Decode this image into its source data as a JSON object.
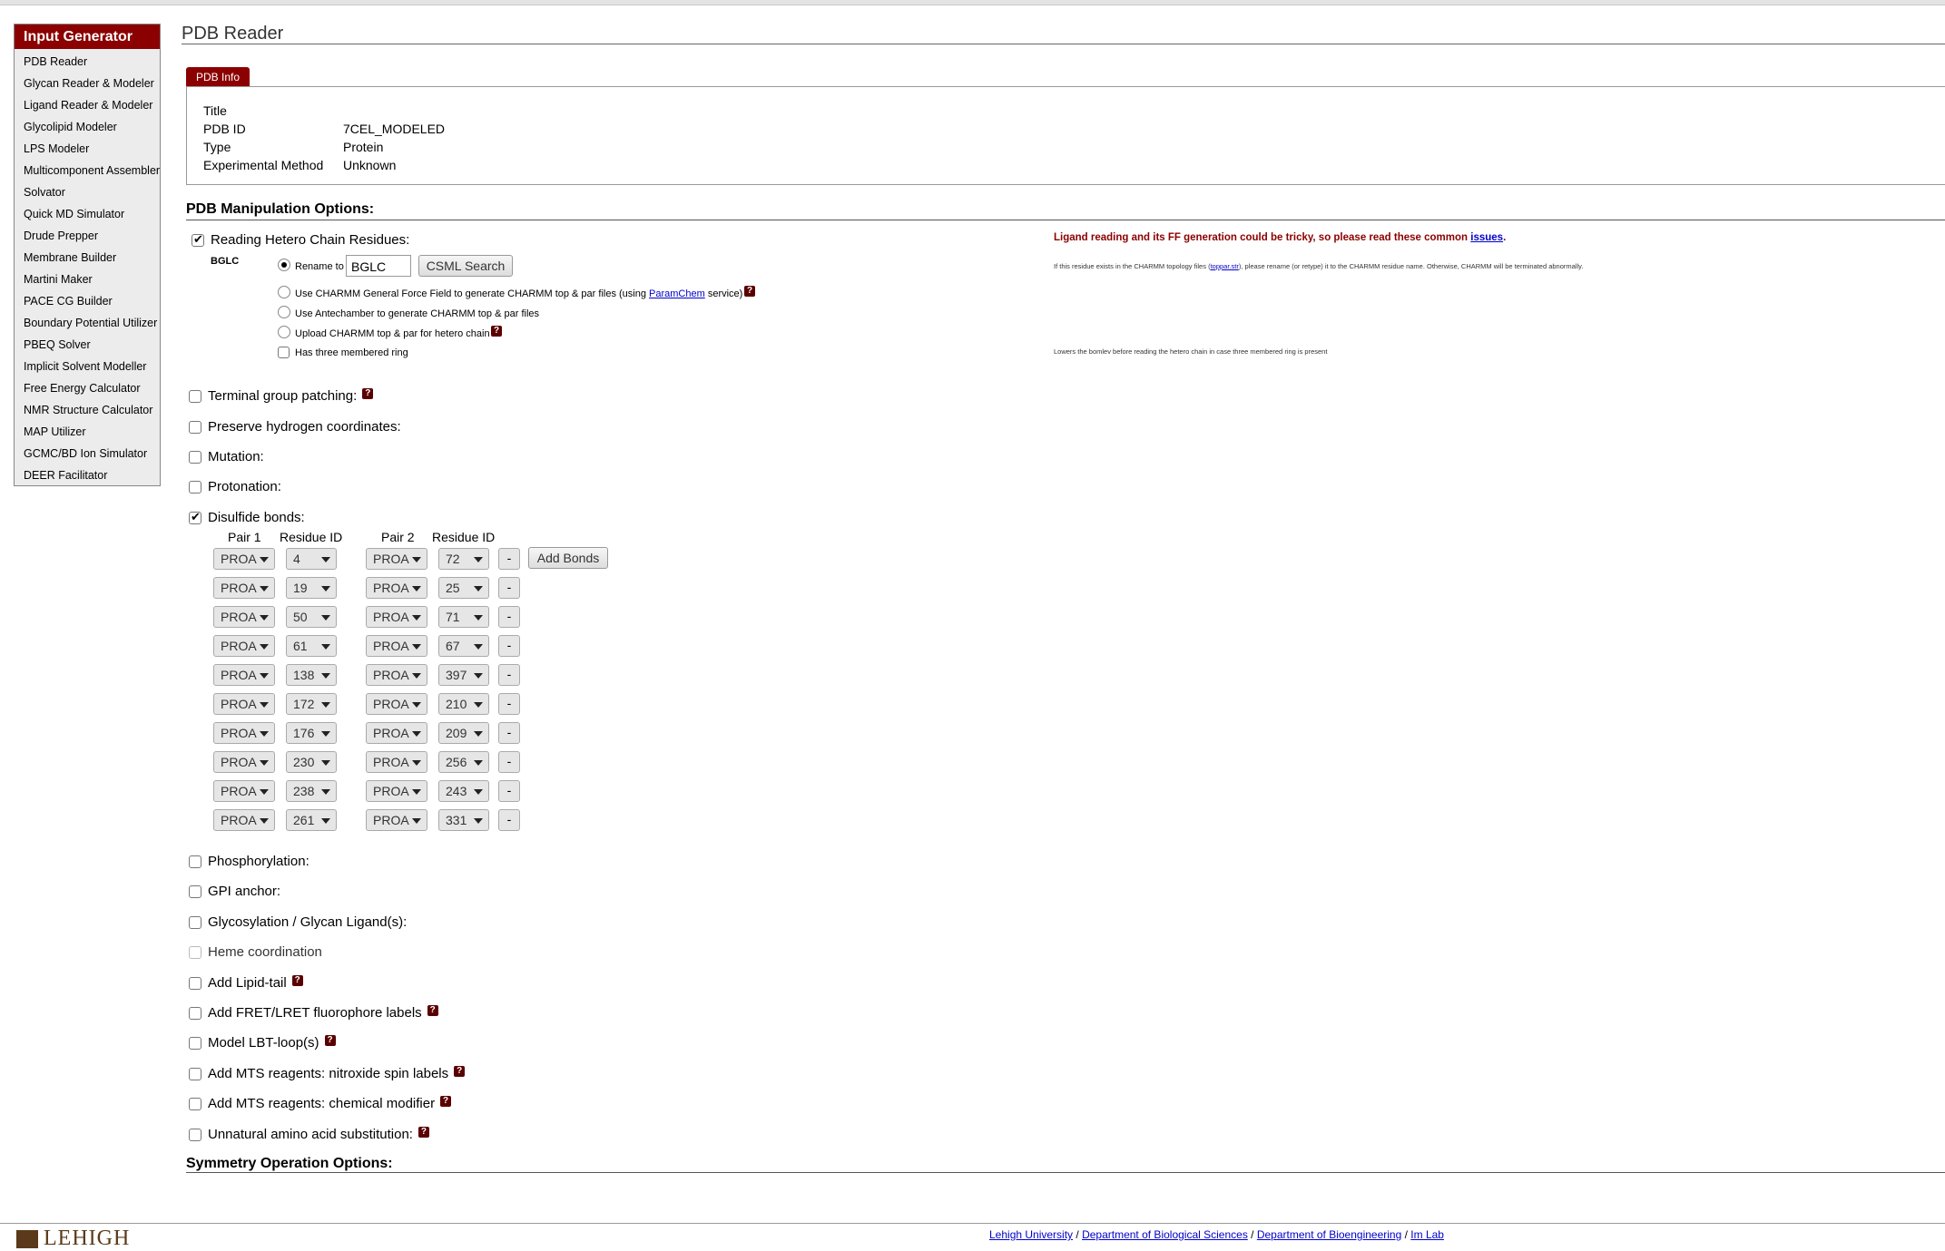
{
  "sidebar": {
    "title": "Input Generator",
    "items": [
      "PDB Reader",
      "Glycan Reader & Modeler",
      "Ligand Reader & Modeler",
      "Glycolipid Modeler",
      "LPS Modeler",
      "Multicomponent Assembler",
      "Solvator",
      "Quick MD Simulator",
      "Drude Prepper",
      "Membrane Builder",
      "Martini Maker",
      "PACE CG Builder",
      "Boundary Potential Utilizer",
      "PBEQ Solver",
      "Implicit Solvent Modeller",
      "Free Energy Calculator",
      "NMR Structure Calculator",
      "MAP Utilizer",
      "GCMC/BD Ion Simulator",
      "DEER Facilitator"
    ]
  },
  "page": {
    "title": "PDB Reader"
  },
  "pdb_info": {
    "tab": "PDB Info",
    "rows": [
      {
        "label": "Title",
        "value": ""
      },
      {
        "label": "PDB ID",
        "value": "7CEL_MODELED"
      },
      {
        "label": "Type",
        "value": "Protein"
      },
      {
        "label": "Experimental Method",
        "value": "Unknown"
      }
    ]
  },
  "manipulation": {
    "title": "PDB Manipulation Options:",
    "hetero": {
      "label": "Reading Hetero Chain Residues:",
      "checked": true,
      "residue": "BGLC",
      "rename_label": "Rename to",
      "rename_value": "BGLC",
      "csml_button": "CSML Search",
      "opt_cgenff_a": "Use CHARMM General Force Field to generate CHARMM top & par files (using ",
      "opt_cgenff_link": "ParamChem",
      "opt_cgenff_b": " service)",
      "opt_antechamber": "Use Antechamber to generate CHARMM top & par files",
      "opt_upload": "Upload CHARMM top & par for hetero chain",
      "three_ring": "Has three membered ring",
      "note_red_a": "Ligand reading and its FF generation could be tricky, so please read these common ",
      "note_red_link": "issues",
      "note_red_b": ".",
      "note_tiny_a": "If this residue exists in the CHARMM topology files (",
      "note_tiny_link": "toppar.str",
      "note_tiny_b": "), please rename (or retype) it to the CHARMM residue name. Otherwise, CHARMM will be terminated abnormally.",
      "note_ring": "Lowers the bomlev before reading the hetero chain in case three membered ring is present"
    },
    "options_top": [
      {
        "label": "Terminal group patching:",
        "checked": false,
        "help": true
      },
      {
        "label": "Preserve hydrogen coordinates:",
        "checked": false,
        "help": false
      },
      {
        "label": "Mutation:",
        "checked": false,
        "help": false
      },
      {
        "label": "Protonation:",
        "checked": false,
        "help": false
      }
    ],
    "disulfide": {
      "label": "Disulfide bonds:",
      "checked": true,
      "headers": {
        "pair1": "Pair 1",
        "res1": "Residue ID",
        "pair2": "Pair 2",
        "res2": "Residue ID"
      },
      "add_button": "Add Bonds",
      "remove_label": "-",
      "bonds": [
        {
          "seg1": "PROA",
          "res1": "4",
          "seg2": "PROA",
          "res2": "72"
        },
        {
          "seg1": "PROA",
          "res1": "19",
          "seg2": "PROA",
          "res2": "25"
        },
        {
          "seg1": "PROA",
          "res1": "50",
          "seg2": "PROA",
          "res2": "71"
        },
        {
          "seg1": "PROA",
          "res1": "61",
          "seg2": "PROA",
          "res2": "67"
        },
        {
          "seg1": "PROA",
          "res1": "138",
          "seg2": "PROA",
          "res2": "397"
        },
        {
          "seg1": "PROA",
          "res1": "172",
          "seg2": "PROA",
          "res2": "210"
        },
        {
          "seg1": "PROA",
          "res1": "176",
          "seg2": "PROA",
          "res2": "209"
        },
        {
          "seg1": "PROA",
          "res1": "230",
          "seg2": "PROA",
          "res2": "256"
        },
        {
          "seg1": "PROA",
          "res1": "238",
          "seg2": "PROA",
          "res2": "243"
        },
        {
          "seg1": "PROA",
          "res1": "261",
          "seg2": "PROA",
          "res2": "331"
        }
      ]
    },
    "options_bottom": [
      {
        "label": "Phosphorylation:",
        "checked": false,
        "help": false,
        "disabled": false
      },
      {
        "label": "GPI anchor:",
        "checked": false,
        "help": false,
        "disabled": false
      },
      {
        "label": "Glycosylation / Glycan Ligand(s):",
        "checked": false,
        "help": false,
        "disabled": false
      },
      {
        "label": "Heme coordination",
        "checked": false,
        "help": false,
        "disabled": true
      },
      {
        "label": "Add Lipid-tail",
        "checked": false,
        "help": true,
        "disabled": false
      },
      {
        "label": "Add FRET/LRET fluorophore labels",
        "checked": false,
        "help": true,
        "disabled": false
      },
      {
        "label": "Model LBT-loop(s)",
        "checked": false,
        "help": true,
        "disabled": false
      },
      {
        "label": "Add MTS reagents: nitroxide spin labels",
        "checked": false,
        "help": true,
        "disabled": false
      },
      {
        "label": "Add MTS reagents: chemical modifier",
        "checked": false,
        "help": true,
        "disabled": false
      },
      {
        "label": "Unnatural amino acid substitution:",
        "checked": false,
        "help": true,
        "disabled": false
      }
    ],
    "help_glyph": "?"
  },
  "symmetry": {
    "title": "Symmetry Operation Options:"
  },
  "footer": {
    "logo_text": "LEHIGH",
    "links": [
      "Lehigh University",
      "Department of Biological Sciences",
      "Department of Bioengineering",
      "Im Lab"
    ],
    "separator": " / "
  },
  "colors": {
    "brand": "#8b0000",
    "help_icon": "#5a0000",
    "link": "#0000cc"
  }
}
